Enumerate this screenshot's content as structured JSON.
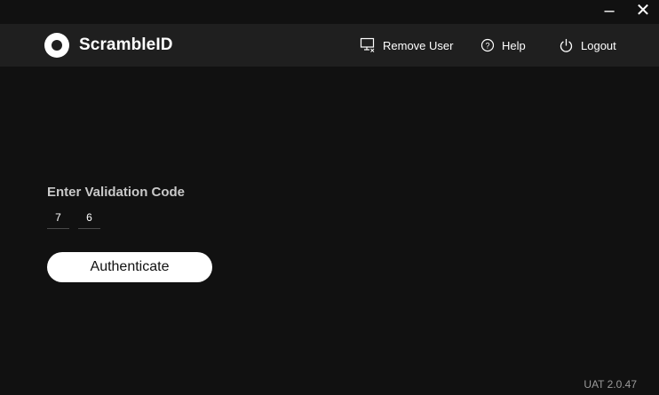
{
  "titlebar": {
    "minimize_glyph": "–",
    "close_glyph": "✕"
  },
  "header": {
    "brand_name": "ScrambleID",
    "nav": {
      "remove_user": {
        "label": "Remove User",
        "icon": "remove-user-icon"
      },
      "help": {
        "label": "Help",
        "icon": "help-icon"
      },
      "logout": {
        "label": "Logout",
        "icon": "power-icon"
      }
    }
  },
  "main": {
    "validation_label": "Enter Validation Code",
    "code_digits": [
      "7",
      "6"
    ],
    "authenticate_label": "Authenticate"
  },
  "footer": {
    "version": "UAT 2.0.47"
  },
  "colors": {
    "background": "#111111",
    "header": "#1f1f1f",
    "button": "#ffffff"
  }
}
